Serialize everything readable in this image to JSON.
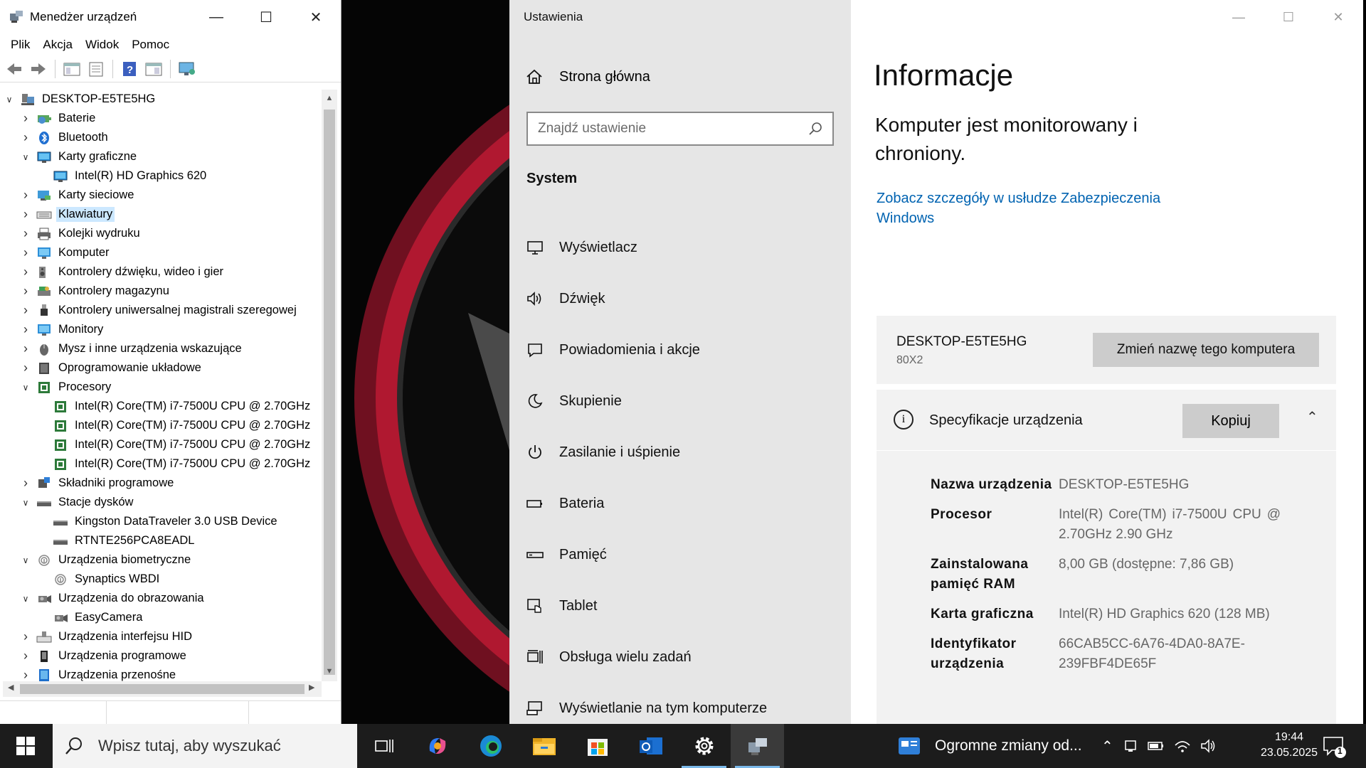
{
  "device_manager": {
    "title": "Menedżer urządzeń",
    "menu": [
      "Plik",
      "Akcja",
      "Widok",
      "Pomoc"
    ],
    "tree": [
      {
        "label": "DESKTOP-E5TE5HG",
        "level": 0,
        "state": "expanded",
        "icon": "computer-root-icon"
      },
      {
        "label": "Baterie",
        "level": 1,
        "state": "collapsed",
        "icon": "battery-icon"
      },
      {
        "label": "Bluetooth",
        "level": 1,
        "state": "collapsed",
        "icon": "bluetooth-icon"
      },
      {
        "label": "Karty graficzne",
        "level": 1,
        "state": "expanded",
        "icon": "display-adapter-icon"
      },
      {
        "label": "Intel(R) HD Graphics 620",
        "level": 2,
        "state": "leaf",
        "icon": "display-adapter-icon"
      },
      {
        "label": "Karty sieciowe",
        "level": 1,
        "state": "collapsed",
        "icon": "network-adapter-icon"
      },
      {
        "label": "Klawiatury",
        "level": 1,
        "state": "collapsed",
        "icon": "keyboard-icon",
        "selected": true
      },
      {
        "label": "Kolejki wydruku",
        "level": 1,
        "state": "collapsed",
        "icon": "printer-icon"
      },
      {
        "label": "Komputer",
        "level": 1,
        "state": "collapsed",
        "icon": "monitor-icon"
      },
      {
        "label": "Kontrolery dźwięku, wideo i gier",
        "level": 1,
        "state": "collapsed",
        "icon": "speaker-icon"
      },
      {
        "label": "Kontrolery magazynu",
        "level": 1,
        "state": "collapsed",
        "icon": "storage-controller-icon"
      },
      {
        "label": "Kontrolery uniwersalnej magistrali szeregowej",
        "level": 1,
        "state": "collapsed",
        "icon": "usb-icon"
      },
      {
        "label": "Monitory",
        "level": 1,
        "state": "collapsed",
        "icon": "monitor-icon"
      },
      {
        "label": "Mysz i inne urządzenia wskazujące",
        "level": 1,
        "state": "collapsed",
        "icon": "mouse-icon"
      },
      {
        "label": "Oprogramowanie układowe",
        "level": 1,
        "state": "collapsed",
        "icon": "firmware-icon"
      },
      {
        "label": "Procesory",
        "level": 1,
        "state": "expanded",
        "icon": "processor-icon"
      },
      {
        "label": "Intel(R) Core(TM) i7-7500U CPU @ 2.70GHz",
        "level": 2,
        "state": "leaf",
        "icon": "processor-icon"
      },
      {
        "label": "Intel(R) Core(TM) i7-7500U CPU @ 2.70GHz",
        "level": 2,
        "state": "leaf",
        "icon": "processor-icon"
      },
      {
        "label": "Intel(R) Core(TM) i7-7500U CPU @ 2.70GHz",
        "level": 2,
        "state": "leaf",
        "icon": "processor-icon"
      },
      {
        "label": "Intel(R) Core(TM) i7-7500U CPU @ 2.70GHz",
        "level": 2,
        "state": "leaf",
        "icon": "processor-icon"
      },
      {
        "label": "Składniki programowe",
        "level": 1,
        "state": "collapsed",
        "icon": "software-component-icon"
      },
      {
        "label": "Stacje dysków",
        "level": 1,
        "state": "expanded",
        "icon": "disk-drive-icon"
      },
      {
        "label": "Kingston DataTraveler 3.0 USB Device",
        "level": 2,
        "state": "leaf",
        "icon": "disk-drive-icon"
      },
      {
        "label": "RTNTE256PCA8EADL",
        "level": 2,
        "state": "leaf",
        "icon": "disk-drive-icon"
      },
      {
        "label": "Urządzenia biometryczne",
        "level": 1,
        "state": "expanded",
        "icon": "fingerprint-icon"
      },
      {
        "label": "Synaptics WBDI",
        "level": 2,
        "state": "leaf",
        "icon": "fingerprint-icon"
      },
      {
        "label": "Urządzenia do obrazowania",
        "level": 1,
        "state": "expanded",
        "icon": "camera-icon"
      },
      {
        "label": "EasyCamera",
        "level": 2,
        "state": "leaf",
        "icon": "camera-icon"
      },
      {
        "label": "Urządzenia interfejsu HID",
        "level": 1,
        "state": "collapsed",
        "icon": "hid-icon"
      },
      {
        "label": "Urządzenia programowe",
        "level": 1,
        "state": "collapsed",
        "icon": "software-device-icon"
      },
      {
        "label": "Urządzenia przenośne",
        "level": 1,
        "state": "collapsed",
        "icon": "portable-device-icon"
      }
    ]
  },
  "settings": {
    "window_title": "Ustawienia",
    "home_label": "Strona główna",
    "search_placeholder": "Znajdź ustawienie",
    "section_label": "System",
    "nav": [
      {
        "label": "Wyświetlacz",
        "icon": "display-icon"
      },
      {
        "label": "Dźwięk",
        "icon": "sound-icon"
      },
      {
        "label": "Powiadomienia i akcje",
        "icon": "notifications-icon"
      },
      {
        "label": "Skupienie",
        "icon": "focus-moon-icon"
      },
      {
        "label": "Zasilanie i uśpienie",
        "icon": "power-icon"
      },
      {
        "label": "Bateria",
        "icon": "battery-icon"
      },
      {
        "label": "Pamięć",
        "icon": "storage-icon"
      },
      {
        "label": "Tablet",
        "icon": "tablet-icon"
      },
      {
        "label": "Obsługa wielu zadań",
        "icon": "multitasking-icon"
      },
      {
        "label": "Wyświetlanie na tym komputerze",
        "icon": "projecting-icon"
      }
    ],
    "main": {
      "title": "Informacje",
      "subtitle": "Komputer jest monitorowany i chroniony.",
      "link": "Zobacz szczegóły w usłudze Zabezpieczenia Windows",
      "pc_name": "DESKTOP-E5TE5HG",
      "pc_model": "80X2",
      "rename_button": "Zmień nazwę tego komputera",
      "spec_title": "Specyfikacje urządzenia",
      "copy_button": "Kopiuj",
      "specs": [
        {
          "key": "Nazwa urządzenia",
          "value": "DESKTOP-E5TE5HG"
        },
        {
          "key": "Procesor",
          "value": "Intel(R) Core(TM) i7-7500U CPU @ 2.70GHz 2.90 GHz"
        },
        {
          "key": "Zainstalowana pamięć RAM",
          "value": "8,00 GB (dostępne: 7,86 GB)"
        },
        {
          "key": "Karta graficzna",
          "value": "Intel(R) HD Graphics 620 (128 MB)"
        },
        {
          "key": "Identyfikator urządzenia",
          "value": "66CAB5CC-6A76-4DA0-8A7E-239FBF4DE65F"
        }
      ]
    }
  },
  "taskbar": {
    "search_placeholder": "Wpisz tutaj, aby wyszukać",
    "apps": [
      {
        "name": "task-view-icon",
        "active": false
      },
      {
        "name": "copilot-icon",
        "active": false
      },
      {
        "name": "edge-icon",
        "active": false
      },
      {
        "name": "file-explorer-icon",
        "active": false
      },
      {
        "name": "microsoft-store-icon",
        "active": false
      },
      {
        "name": "outlook-icon",
        "active": false
      },
      {
        "name": "settings-gear-icon",
        "active": true
      },
      {
        "name": "device-manager-icon",
        "active": true
      }
    ],
    "news_text": "Ogromne zmiany od...",
    "time": "19:44",
    "date": "23.05.2025",
    "notification_count": "1"
  }
}
